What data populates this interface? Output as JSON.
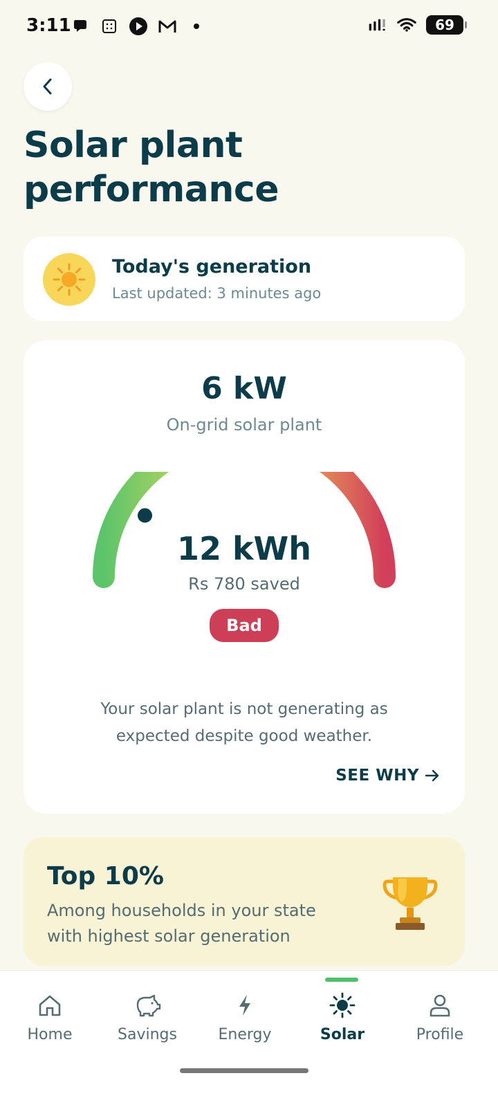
{
  "status_bar": {
    "time": "3:11",
    "battery": "69",
    "left_icons": [
      "chat-bubble-icon",
      "calculator-icon",
      "play-icon",
      "gmail-icon",
      "dot-icon"
    ],
    "right_icons": [
      "signal-icon",
      "wifi-icon",
      "battery-icon"
    ]
  },
  "header": {
    "back_icon": "chevron-left-icon",
    "title": "Solar plant performance"
  },
  "generation_card": {
    "icon": "sun-icon",
    "title": "Today's generation",
    "subtitle": "Last updated: 3 minutes ago"
  },
  "performance": {
    "capacity": "6 kW",
    "plant_type": "On-grid solar plant",
    "energy": "12 kWh",
    "saved": "Rs 780 saved",
    "status": "Bad",
    "gauge_level": 0.25,
    "gauge_colors": [
      "#5cc46a",
      "#f4df5a",
      "#d23f5a"
    ],
    "message": "Your solar plant is not generating as expected despite good weather.",
    "see_why": "SEE WHY"
  },
  "rank_card": {
    "title": "Top 10%",
    "description": "Among households in your state with highest solar generation",
    "icon": "trophy-icon"
  },
  "nav": {
    "items": [
      {
        "label": "Home",
        "icon": "home-icon"
      },
      {
        "label": "Savings",
        "icon": "piggy-bank-icon"
      },
      {
        "label": "Energy",
        "icon": "lightning-icon"
      },
      {
        "label": "Solar",
        "icon": "sun-icon"
      },
      {
        "label": "Profile",
        "icon": "user-icon"
      }
    ],
    "active": "Solar"
  },
  "colors": {
    "background": "#f8f8ef",
    "primary_text": "#0c3b4a",
    "bad_badge": "#cc3f57",
    "accent_green": "#4fc06a",
    "rank_card_bg": "#f7f3d4"
  }
}
